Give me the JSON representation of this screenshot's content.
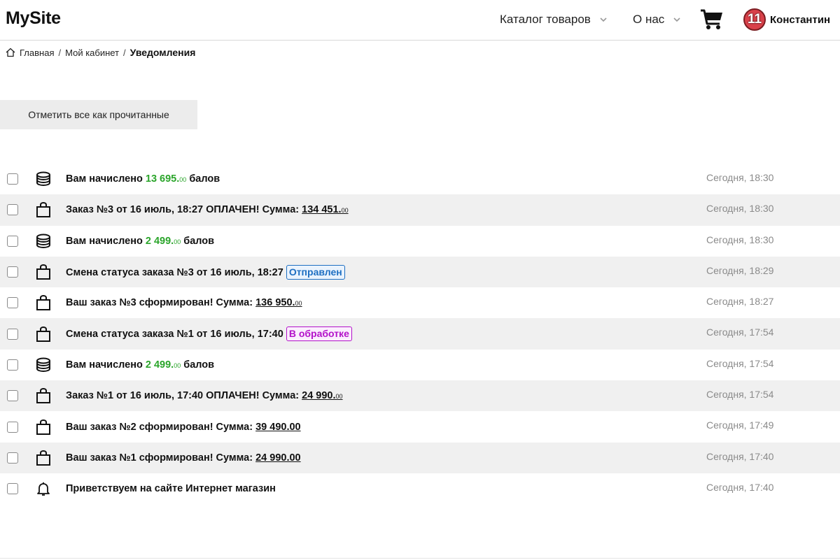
{
  "header": {
    "logo": "MySite",
    "nav": [
      {
        "label": "Каталог товаров"
      },
      {
        "label": "О нас"
      }
    ],
    "user": {
      "badge_count": "11",
      "name": "Константин"
    }
  },
  "breadcrumb": {
    "items": [
      "Главная",
      "Мой кабинет"
    ],
    "separator": "/",
    "current": "Уведомления"
  },
  "mark_all_label": "Отметить все как прочитанные",
  "notifications": [
    {
      "icon": "coins-icon",
      "parts": {
        "a": "Вам начислено ",
        "amount": "13 695.",
        "cents": "00",
        "b": " балов"
      },
      "time": "Сегодня, 18:30"
    },
    {
      "icon": "bag-icon",
      "parts": {
        "a": "Заказ №3 от 16 июль, 18:27 ОПЛАЧЕН! Сумма: ",
        "sum": "134 451.",
        "cents": "00"
      },
      "time": "Сегодня, 18:30"
    },
    {
      "icon": "coins-icon",
      "parts": {
        "a": "Вам начислено ",
        "amount": "2 499.",
        "cents": "00",
        "b": " балов"
      },
      "time": "Сегодня, 18:30"
    },
    {
      "icon": "bag-icon",
      "parts": {
        "a": "Смена статуса заказа №3 от 16 июль, 18:27 ",
        "status": "Отправлен"
      },
      "time": "Сегодня, 18:29"
    },
    {
      "icon": "bag-icon",
      "parts": {
        "a": "Ваш заказ №3 сформирован! Сумма: ",
        "sum": "136 950.",
        "cents": "00"
      },
      "time": "Сегодня, 18:27"
    },
    {
      "icon": "bag-icon",
      "parts": {
        "a": "Смена статуса заказа №1 от 16 июль, 17:40 ",
        "status": "В обработке"
      },
      "time": "Сегодня, 17:54"
    },
    {
      "icon": "coins-icon",
      "parts": {
        "a": "Вам начислено ",
        "amount": "2 499.",
        "cents": "00",
        "b": " балов"
      },
      "time": "Сегодня, 17:54"
    },
    {
      "icon": "bag-icon",
      "parts": {
        "a": "Заказ №1 от 16 июль, 17:40 ОПЛАЧЕН! Сумма: ",
        "sum": "24 990.",
        "cents": "00"
      },
      "time": "Сегодня, 17:54"
    },
    {
      "icon": "bag-icon",
      "parts": {
        "a": "Ваш заказ №2 сформирован! Сумма: ",
        "sum": "39 490.00"
      },
      "time": "Сегодня, 17:49"
    },
    {
      "icon": "bag-icon",
      "parts": {
        "a": "Ваш заказ №1 сформирован! Сумма: ",
        "sum": "24 990.00"
      },
      "time": "Сегодня, 17:40"
    },
    {
      "icon": "bell-icon",
      "parts": {
        "a": "Приветствуем на сайте Интернет магазин"
      },
      "time": "Сегодня, 17:40"
    }
  ],
  "colors": {
    "accent_green": "#2ba52b",
    "status_blue": "#1e6fc2",
    "status_purple": "#b312c9",
    "badge_red": "#d9414a"
  }
}
